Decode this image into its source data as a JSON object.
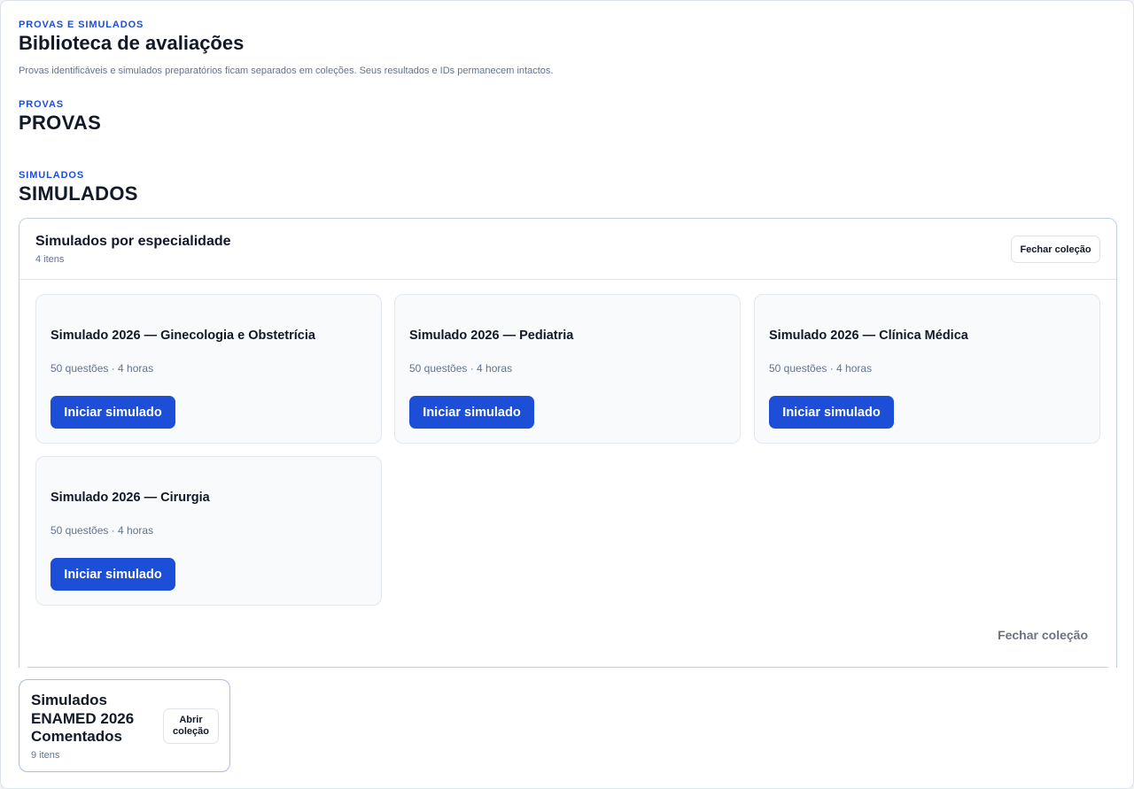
{
  "header": {
    "eyebrow": "PROVAS E SIMULADOS",
    "title": "Biblioteca de avaliações",
    "description": "Provas identificáveis e simulados preparatórios ficam separados em coleções. Seus resultados e IDs permanecem intactos."
  },
  "provas": {
    "eyebrow": "PROVAS",
    "title": "PROVAS"
  },
  "simulados": {
    "eyebrow": "SIMULADOS",
    "title": "SIMULADOS",
    "collection": {
      "title": "Simulados por especialidade",
      "count": "4 itens",
      "close_label": "Fechar coleção",
      "close_bottom_label": "Fechar coleção",
      "cards": [
        {
          "title": "Simulado 2026 — Ginecologia e Obstetrícia",
          "meta": "50 questões · 4 horas",
          "button": "Iniciar simulado"
        },
        {
          "title": "Simulado 2026 — Pediatria",
          "meta": "50 questões · 4 horas",
          "button": "Iniciar simulado"
        },
        {
          "title": "Simulado 2026 — Clínica Médica",
          "meta": "50 questões · 4 horas",
          "button": "Iniciar simulado"
        },
        {
          "title": "Simulado 2026 — Cirurgia",
          "meta": "50 questões · 4 horas",
          "button": "Iniciar simulado"
        }
      ]
    },
    "collection2": {
      "title": "Simulados ENAMED 2026 Comentados",
      "count": "9 itens",
      "open_label": "Abrir coleção"
    }
  },
  "colors": {
    "accent": "#1d4ed8",
    "border": "#bfd0ea",
    "muted": "#64748b"
  }
}
